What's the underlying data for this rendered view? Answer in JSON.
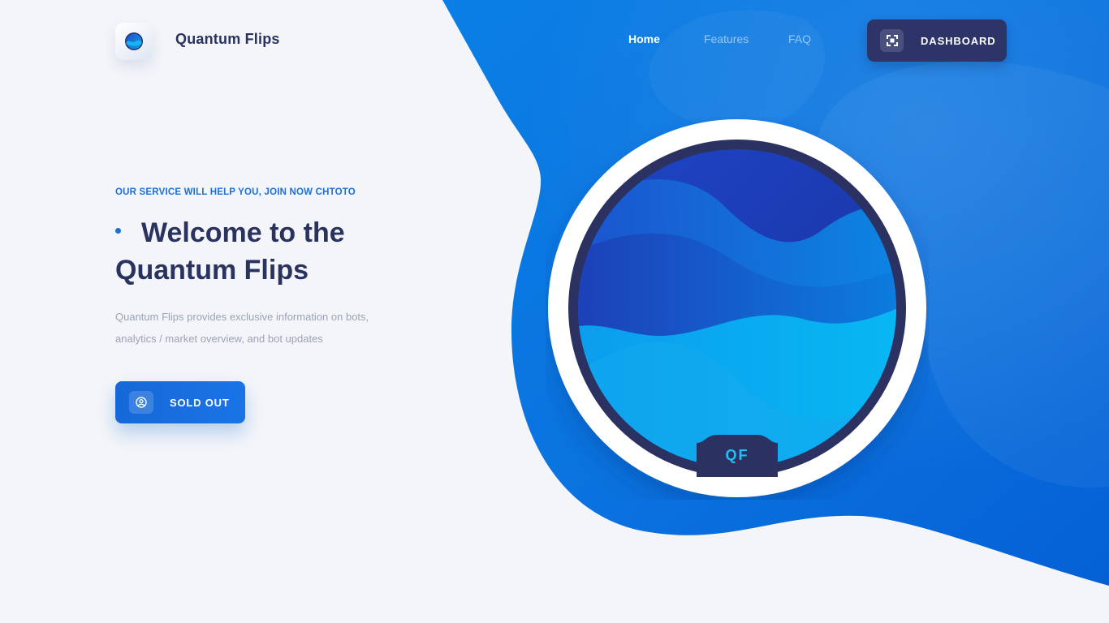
{
  "brand": {
    "name": "Quantum Flips",
    "logo_icon": "globe-wave-icon"
  },
  "nav": {
    "items": [
      {
        "label": "Home",
        "active": true
      },
      {
        "label": "Features",
        "active": false
      },
      {
        "label": "FAQ",
        "active": false
      }
    ],
    "dashboard_label": "DASHBOARD",
    "dashboard_icon": "expand-icon"
  },
  "hero": {
    "kicker": "OUR SERVICE WILL HELP YOU, JOIN NOW CHTOTO",
    "title_line1": "Welcome to the",
    "title_line2": "Quantum Flips",
    "description": "Quantum Flips provides exclusive information on bots, analytics / market overview, and bot updates",
    "cta_label": "SOLD OUT",
    "cta_icon": "user-circle-icon"
  },
  "orb": {
    "badge_text": "QF"
  },
  "colors": {
    "accent": "#1e6fd6",
    "navy": "#2a3260",
    "blob_blue": "#0a73e0",
    "muted_text": "#9aa3b8"
  }
}
